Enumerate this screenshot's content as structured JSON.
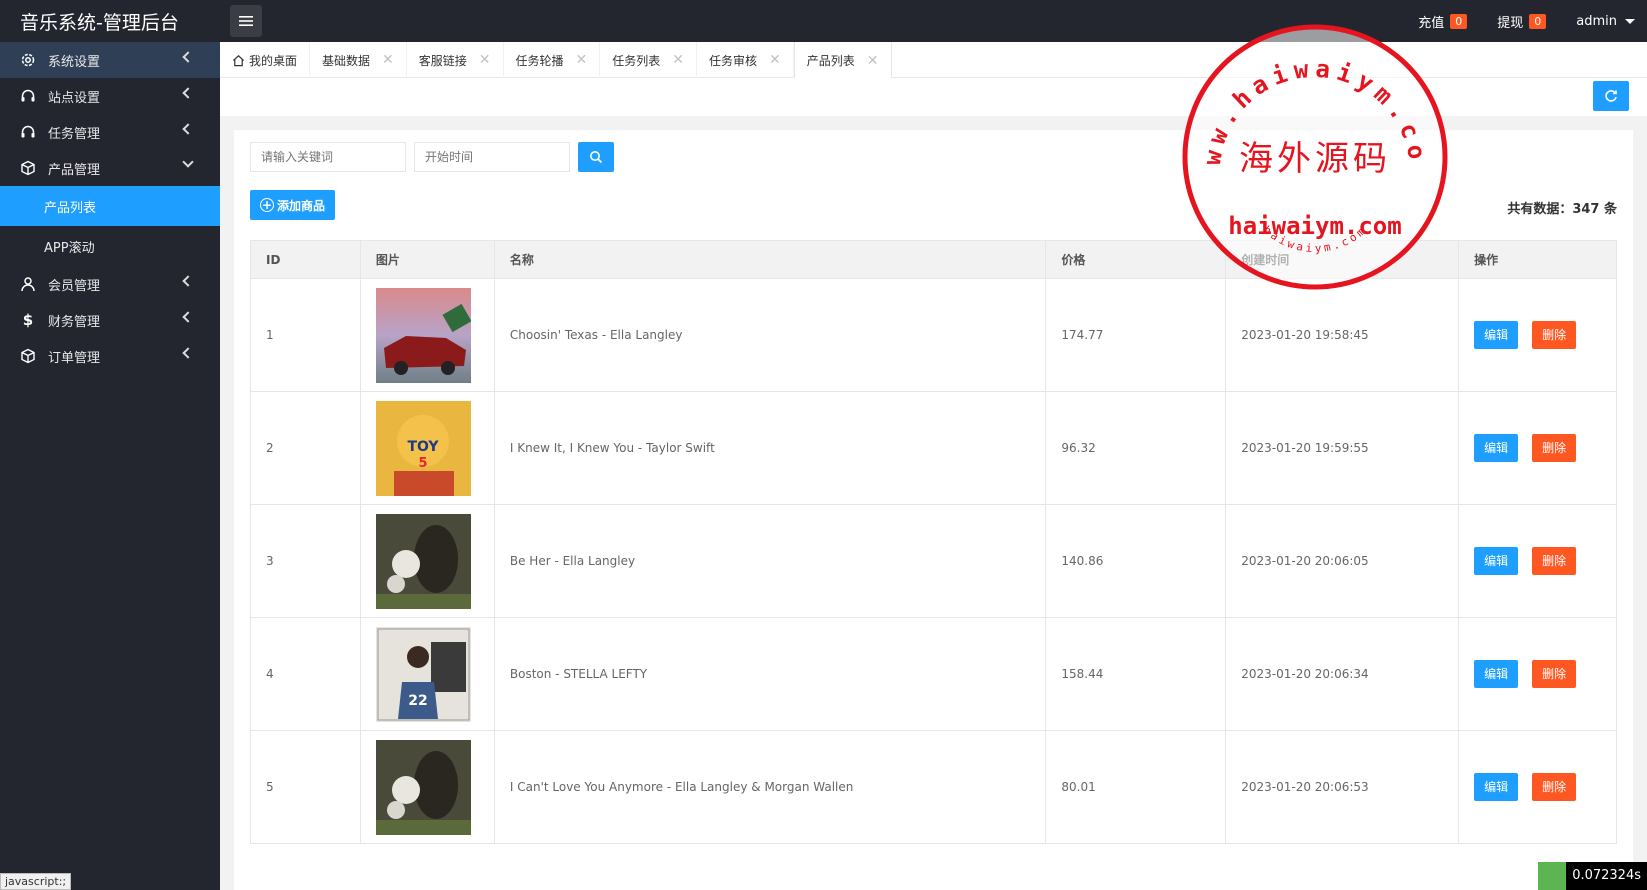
{
  "header": {
    "title": "音乐系统-管理后台",
    "recharge_label": "充值",
    "recharge_count": "0",
    "withdraw_label": "提现",
    "withdraw_count": "0",
    "user": "admin"
  },
  "sidebar": {
    "items": [
      {
        "label": "系统设置",
        "icon": "gear-icon"
      },
      {
        "label": "站点设置",
        "icon": "headset-icon"
      },
      {
        "label": "任务管理",
        "icon": "headset-icon"
      },
      {
        "label": "产品管理",
        "icon": "cube-icon"
      },
      {
        "label": "会员管理",
        "icon": "user-icon"
      },
      {
        "label": "财务管理",
        "icon": "dollar-icon"
      },
      {
        "label": "订单管理",
        "icon": "cube-icon"
      }
    ],
    "sub_items": [
      {
        "label": "产品列表"
      },
      {
        "label": "APP滚动"
      }
    ],
    "status_text": "javascript:;"
  },
  "tabs": [
    {
      "label": "我的桌面"
    },
    {
      "label": "基础数据"
    },
    {
      "label": "客服链接"
    },
    {
      "label": "任务轮播"
    },
    {
      "label": "任务列表"
    },
    {
      "label": "任务审核"
    },
    {
      "label": "产品列表"
    }
  ],
  "search": {
    "keyword_placeholder": "请输入关键词",
    "start_time_placeholder": "开始时间"
  },
  "add_button_label": "添加商品",
  "total_label": "共有数据：347 条",
  "table": {
    "columns": [
      "ID",
      "图片",
      "名称",
      "价格",
      "创建时间",
      "操作"
    ],
    "rows": [
      {
        "id": "1",
        "name": "Choosin' Texas - Ella Langley",
        "price": "174.77",
        "created": "2023-01-20 19:58:45"
      },
      {
        "id": "2",
        "name": "I Knew It, I Knew You - Taylor Swift",
        "price": "96.32",
        "created": "2023-01-20 19:59:55"
      },
      {
        "id": "3",
        "name": "Be Her - Ella Langley",
        "price": "140.86",
        "created": "2023-01-20 20:06:05"
      },
      {
        "id": "4",
        "name": "Boston - STELLA LEFTY",
        "price": "158.44",
        "created": "2023-01-20 20:06:34"
      },
      {
        "id": "5",
        "name": "I Can't Love You Anymore - Ella Langley & Morgan Wallen",
        "price": "80.01",
        "created": "2023-01-20 20:06:53"
      }
    ],
    "edit_label": "编辑",
    "delete_label": "删除"
  },
  "stamp": {
    "top_text": "www.haiwaiym.com",
    "center_text": "海外源码",
    "domain_text": "haiwaiym.com",
    "bottom_text": "haiwaiym.com"
  },
  "timer": "0.072324s",
  "colors": {
    "primary": "#1e9fff",
    "danger": "#ff5722",
    "dark": "#23262e"
  }
}
